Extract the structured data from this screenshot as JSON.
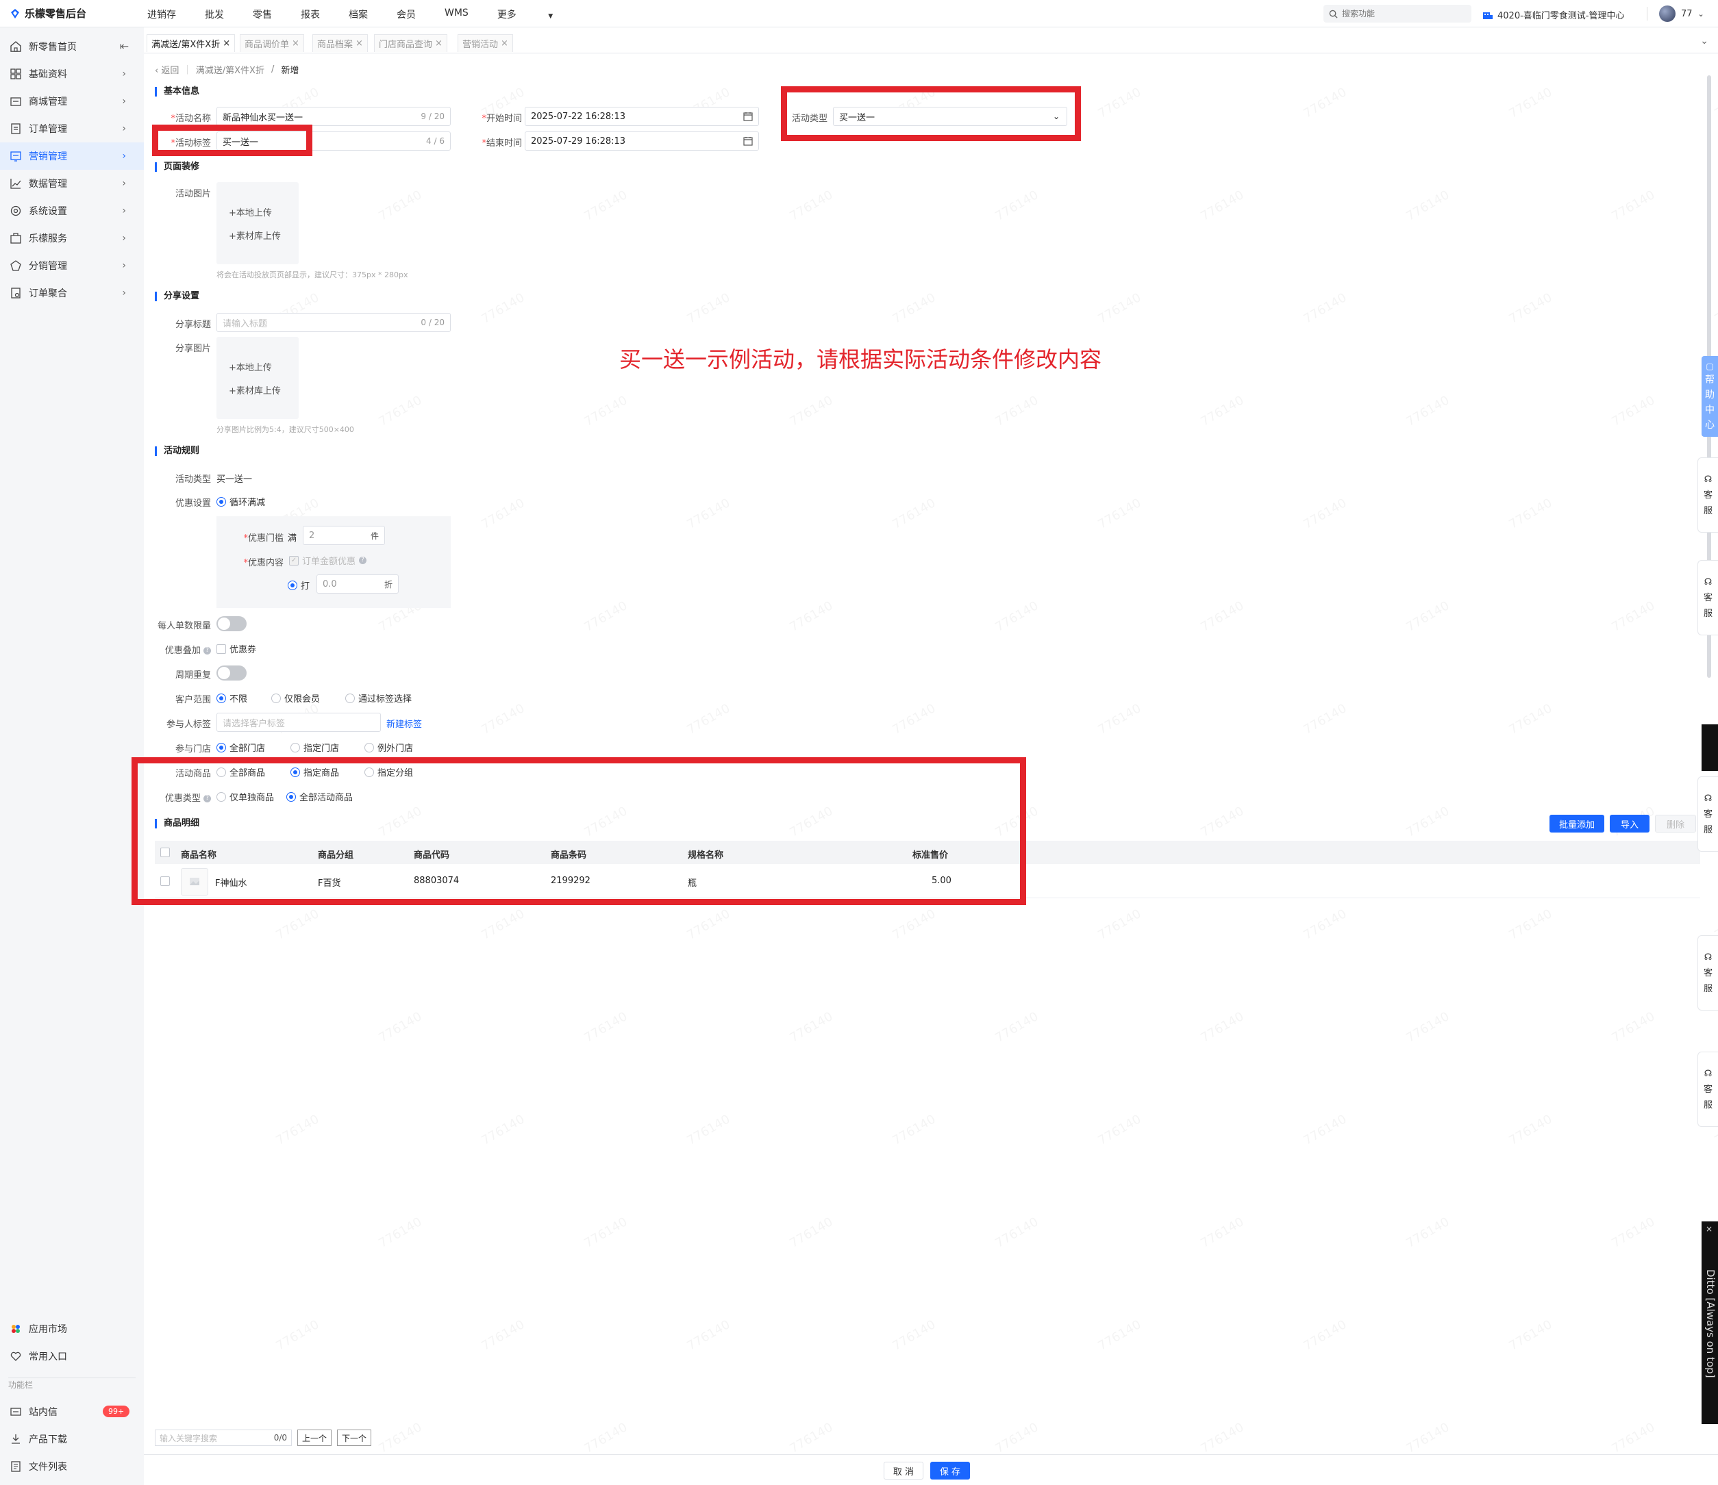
{
  "app": {
    "title": "乐檬零售后台"
  },
  "topnav": [
    "进销存",
    "批发",
    "零售",
    "报表",
    "档案",
    "会员",
    "WMS",
    "更多"
  ],
  "search": {
    "placeholder": "搜索功能"
  },
  "store": {
    "label": "4020-喜临门零食测试-管理中心"
  },
  "user": {
    "name": "77"
  },
  "sidebar": {
    "items": [
      {
        "label": "新零售首页",
        "icon": "home-icon"
      },
      {
        "label": "基础资料",
        "icon": "grid-icon"
      },
      {
        "label": "商城管理",
        "icon": "store-icon"
      },
      {
        "label": "订单管理",
        "icon": "order-icon"
      },
      {
        "label": "营销管理",
        "icon": "marketing-icon",
        "active": true
      },
      {
        "label": "数据管理",
        "icon": "chart-icon"
      },
      {
        "label": "系统设置",
        "icon": "settings-icon"
      },
      {
        "label": "乐檬服务",
        "icon": "service-icon"
      },
      {
        "label": "分销管理",
        "icon": "distribution-icon"
      },
      {
        "label": "订单聚合",
        "icon": "aggregate-icon"
      }
    ],
    "bottom": [
      {
        "label": "应用市场",
        "icon": "apps-icon"
      },
      {
        "label": "常用入口",
        "icon": "heart-icon"
      }
    ],
    "section_label": "功能栏",
    "func": [
      {
        "label": "站内信",
        "icon": "mail-icon",
        "badge": "99+"
      },
      {
        "label": "产品下载",
        "icon": "download-icon"
      },
      {
        "label": "文件列表",
        "icon": "file-icon"
      }
    ]
  },
  "tabs": [
    {
      "label": "满减送/第X件X折",
      "active": true
    },
    {
      "label": "商品调价单"
    },
    {
      "label": "商品档案"
    },
    {
      "label": "门店商品查询"
    },
    {
      "label": "营销活动"
    }
  ],
  "breadcrumb": {
    "back": "返回",
    "parent": "满减送/第X件X折",
    "sep": "/",
    "current": "新增"
  },
  "basic": {
    "title": "基本信息",
    "name_label": "活动名称",
    "name_value": "新品神仙水买一送一",
    "name_count": "9 / 20",
    "tag_label": "活动标签",
    "tag_value": "买一送一",
    "tag_count": "4 / 6",
    "start_label": "开始时间",
    "start_value": "2025-07-22 16:28:13",
    "end_label": "结束时间",
    "end_value": "2025-07-29 16:28:13",
    "type_label": "活动类型",
    "type_value": "买一送一"
  },
  "decor": {
    "title": "页面装修",
    "image_label": "活动图片",
    "upload_local": "+本地上传",
    "upload_lib": "+素材库上传",
    "hint": "将会在活动投放页页部显示，建议尺寸：375px * 280px"
  },
  "share": {
    "title": "分享设置",
    "title_label": "分享标题",
    "title_placeholder": "请输入标题",
    "title_count": "0 / 20",
    "image_label": "分享图片",
    "upload_local": "+本地上传",
    "upload_lib": "+素材库上传",
    "hint": "分享图片比例为5:4，建议尺寸500×400"
  },
  "rules": {
    "title": "活动规则",
    "type_label": "活动类型",
    "type_value": "买一送一",
    "discount_label": "优惠设置",
    "discount_option": "循环满减",
    "threshold_label": "优惠门槛",
    "threshold_prefix": "满",
    "threshold_value": "2",
    "threshold_unit": "件",
    "content_label": "优惠内容",
    "content_check": "订单金额优惠",
    "discount_prefix": "打",
    "discount_value": "0.0",
    "discount_unit": "折",
    "limit_label": "每人单数限量",
    "stack_label": "优惠叠加",
    "stack_option": "优惠券",
    "cycle_label": "周期重复",
    "customer_label": "客户范围",
    "customer_options": [
      "不限",
      "仅限会员",
      "通过标签选择"
    ],
    "tag_label": "参与人标签",
    "tag_placeholder": "请选择客户标签",
    "tag_link": "新建标签",
    "store_label": "参与门店",
    "store_options": [
      "全部门店",
      "指定门店",
      "例外门店"
    ],
    "goods_label": "活动商品",
    "goods_options": [
      "全部商品",
      "指定商品",
      "指定分组"
    ],
    "ptype_label": "优惠类型",
    "ptype_options": [
      "仅单独商品",
      "全部活动商品"
    ]
  },
  "goods": {
    "title": "商品明细",
    "batch_add": "批量添加",
    "import": "导入",
    "delete": "删除",
    "columns": [
      "商品名称",
      "商品分组",
      "商品代码",
      "商品条码",
      "规格名称",
      "标准售价"
    ],
    "rows": [
      {
        "name": "F神仙水",
        "group": "F百货",
        "code": "88803074",
        "barcode": "2199292",
        "spec": "瓶",
        "price": "5.00"
      }
    ]
  },
  "annotation": "买一送一示例活动，请根据实际活动条件修改内容",
  "helpcenter": [
    "帮",
    "助",
    "中",
    "心"
  ],
  "service": [
    "客",
    "服"
  ],
  "ditto": "Ditto [Always on top]",
  "findbar": {
    "placeholder": "输入关键字搜索",
    "count": "0/0",
    "prev": "上一个",
    "next": "下一个"
  },
  "footer": {
    "cancel": "取 消",
    "save": "保 存"
  },
  "watermark": "776140",
  "colors": {
    "primary": "#1a66ff",
    "annotation_red": "#e3242b",
    "badge_red": "#ff4d4f"
  }
}
